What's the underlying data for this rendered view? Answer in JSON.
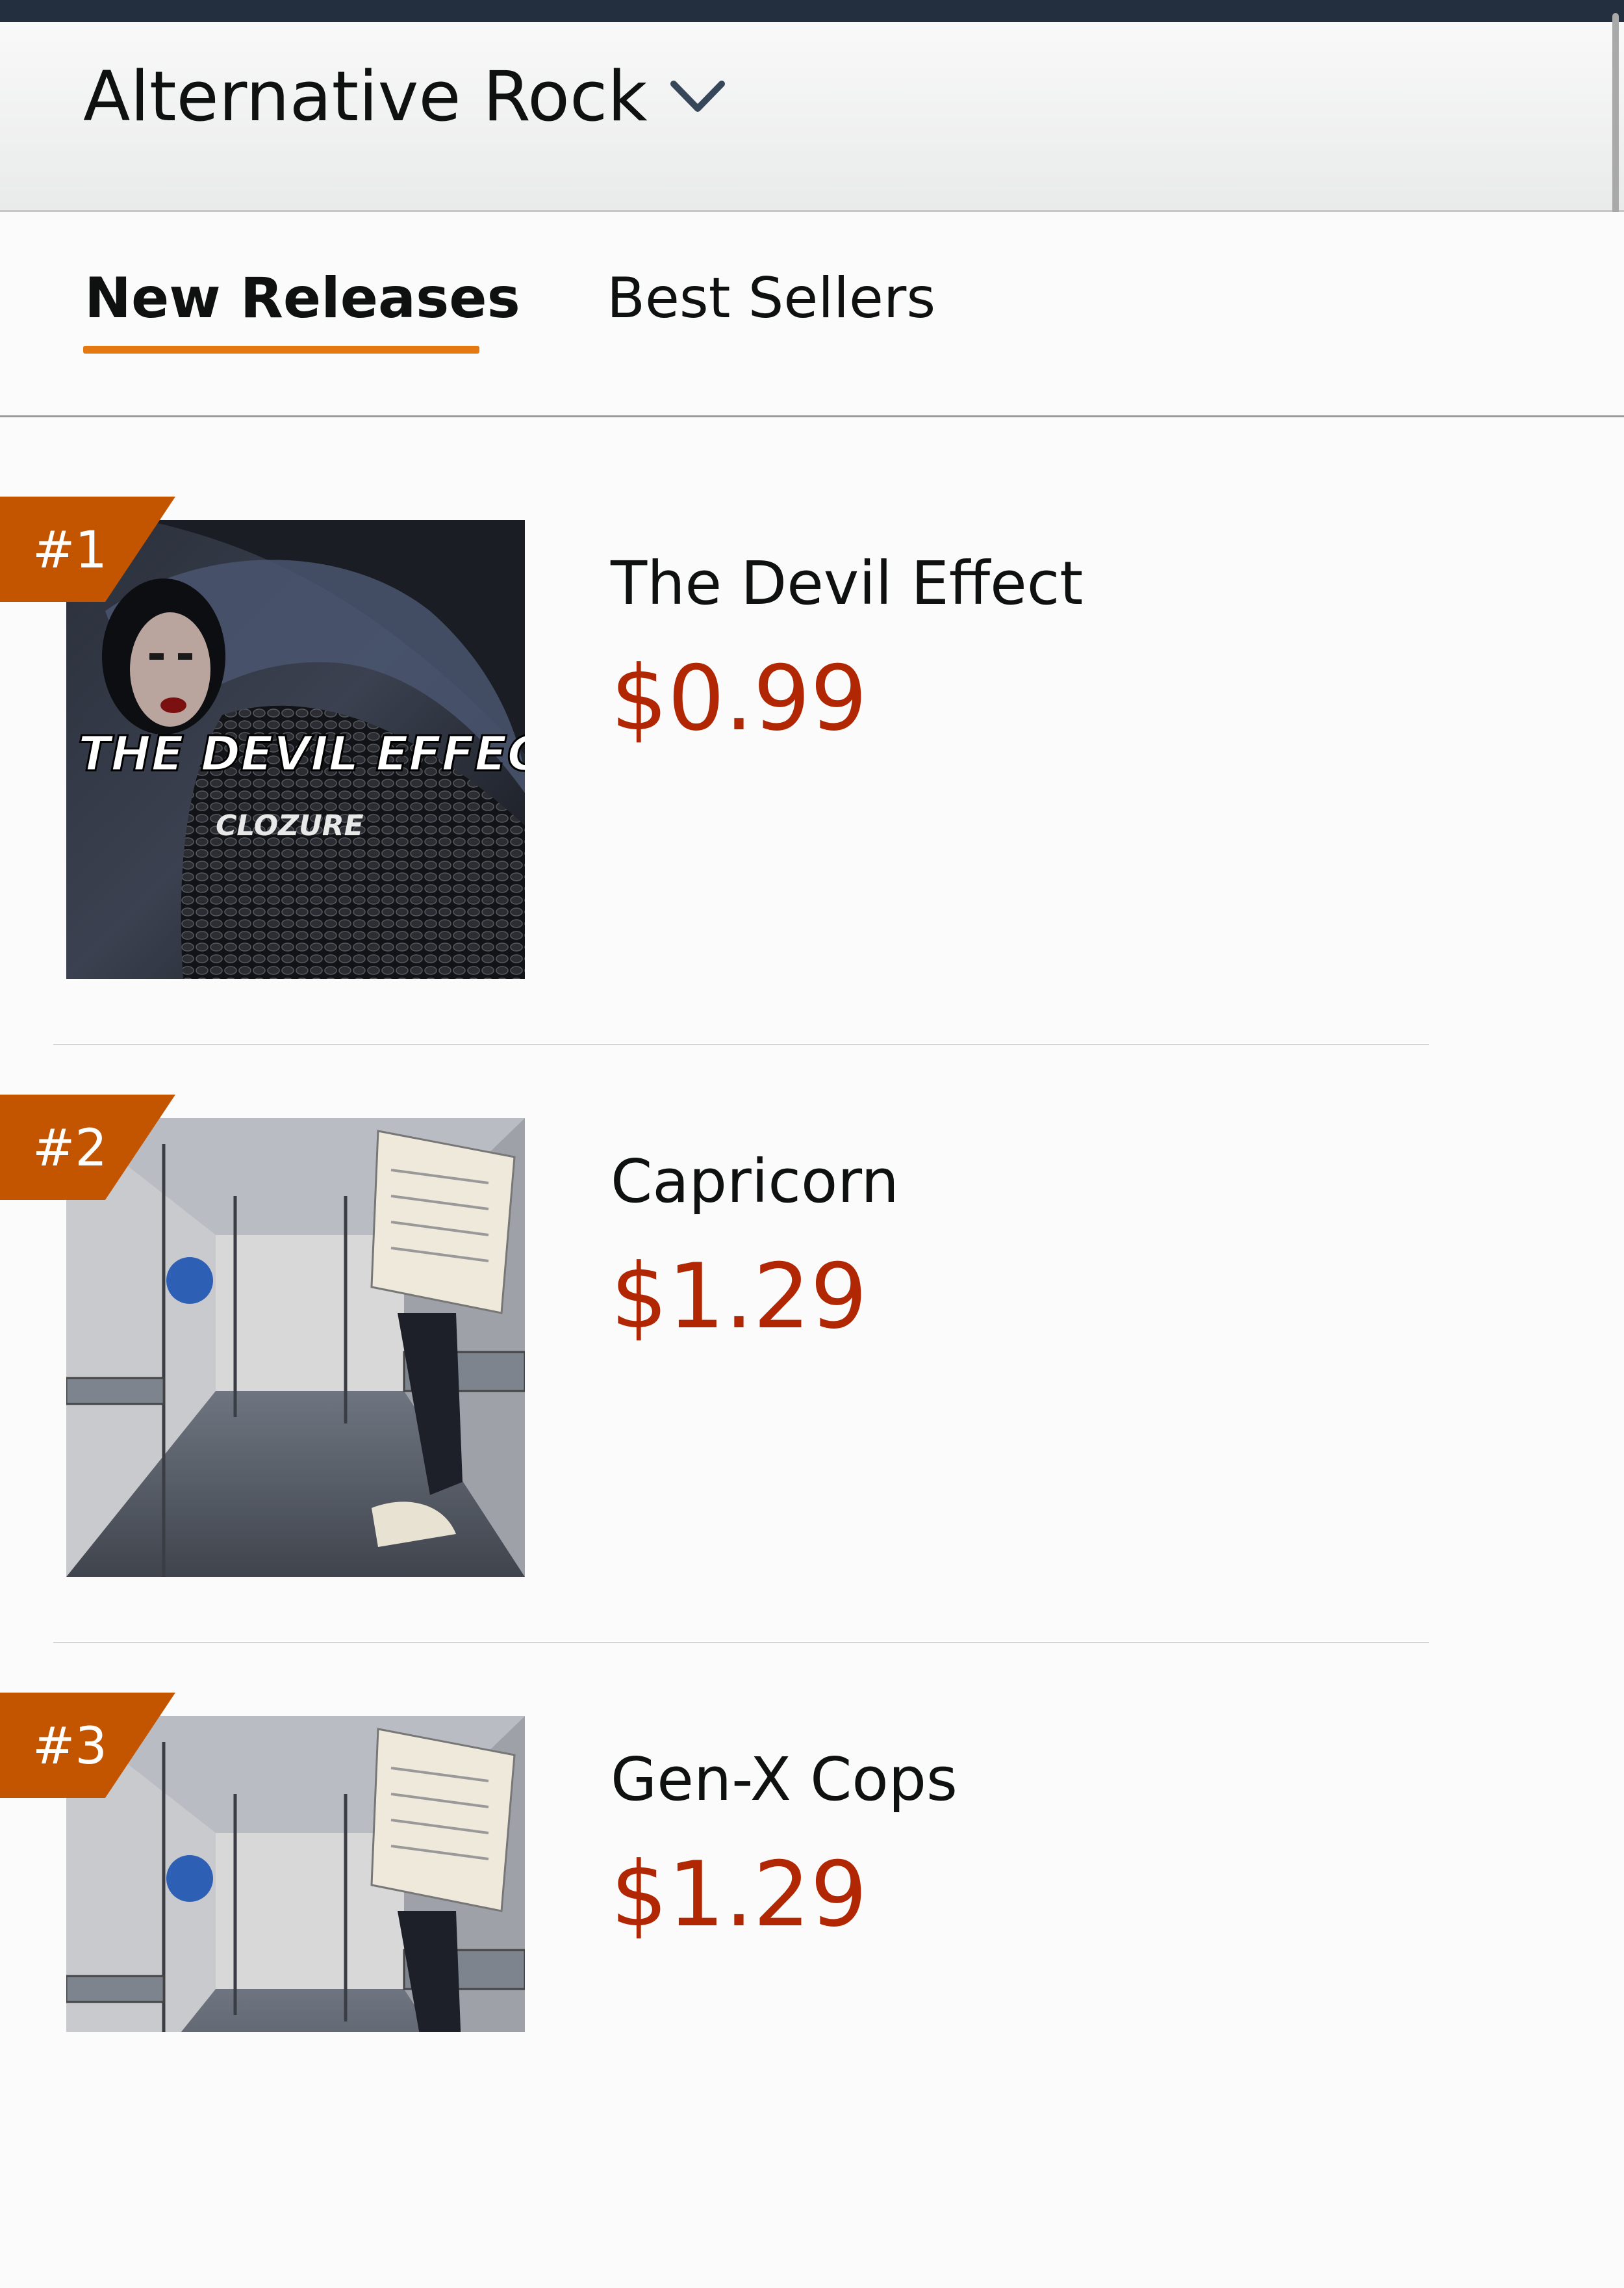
{
  "header": {
    "category": "Alternative Rock",
    "category_icon": "chevron-down-icon"
  },
  "tabs": [
    {
      "label": "New Releases",
      "active": true
    },
    {
      "label": "Best Sellers",
      "active": false
    }
  ],
  "items": [
    {
      "rank": "#1",
      "title": "The Devil Effect",
      "price": "$0.99",
      "cover_title": "THE DEVIL EFFECT",
      "cover_artist": "CLOZURE"
    },
    {
      "rank": "#2",
      "title": "Capricorn",
      "price": "$1.29"
    },
    {
      "rank": "#3",
      "title": "Gen-X Cops",
      "price": "$1.29"
    }
  ],
  "colors": {
    "accent_underline": "#e47911",
    "rank_badge": "#c45500",
    "price": "#b12704",
    "top_bar": "#232f3e"
  }
}
